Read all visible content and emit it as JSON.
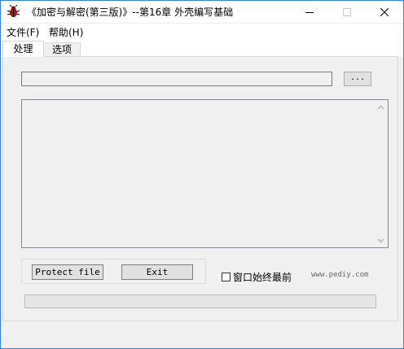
{
  "window": {
    "title": "《加密与解密(第三版)》--第16章 外壳编写基础",
    "icon": "bug-icon",
    "controls": [
      "minimize-icon",
      "maximize-icon",
      "close-icon"
    ]
  },
  "menu": {
    "items": [
      {
        "label": "文件(F)"
      },
      {
        "label": "帮助(H)"
      }
    ]
  },
  "tabs": [
    {
      "label": "处理",
      "active": true
    },
    {
      "label": "选项",
      "active": false
    }
  ],
  "process": {
    "file_path": "",
    "browse_label": "...",
    "log_text": "",
    "protect_label": "Protect file",
    "exit_label": "Exit",
    "topmost_label": "窗口始终最前",
    "topmost_checked": false,
    "site": "www.pediy.com",
    "progress": 0
  },
  "colors": {
    "window_border": "#3b7fd6",
    "face": "#f0f0f0",
    "progress_fill": "#06b025"
  }
}
